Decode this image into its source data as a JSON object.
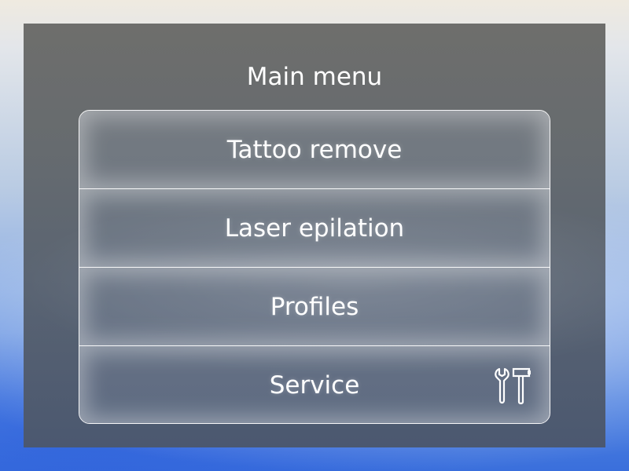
{
  "header": {
    "title": "Main menu"
  },
  "menu": {
    "items": [
      {
        "label": "Tattoo remove"
      },
      {
        "label": "Laser epilation"
      },
      {
        "label": "Profiles"
      },
      {
        "label": "Service",
        "icon": "wrench-hammer-icon"
      }
    ]
  }
}
